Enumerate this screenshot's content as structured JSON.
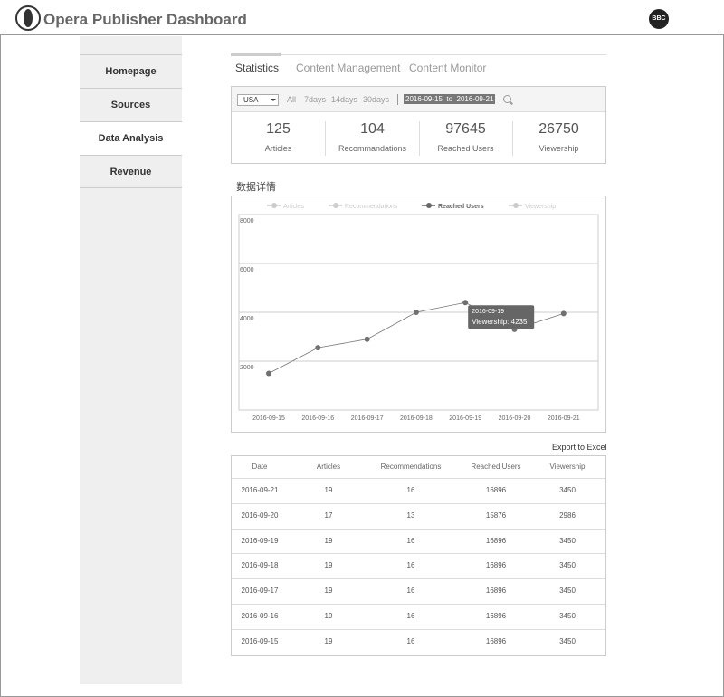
{
  "header": {
    "title": "Opera Publisher Dashboard",
    "avatar_text": "BBC"
  },
  "sidebar": {
    "items": [
      {
        "label": "Homepage"
      },
      {
        "label": "Sources"
      },
      {
        "label": "Data Analysis",
        "active": true
      },
      {
        "label": "Revenue"
      }
    ]
  },
  "tabs": [
    {
      "label": "Statistics",
      "active": true
    },
    {
      "label": "Content Management"
    },
    {
      "label": "Content Monitor"
    }
  ],
  "filters": {
    "country": "USA",
    "ranges": [
      "All",
      "7days",
      "14days",
      "30days"
    ],
    "date_from": "2016-09-15",
    "date_to_word": "to",
    "date_to": "2016-09-21"
  },
  "stats": [
    {
      "value": "125",
      "label": "Articles"
    },
    {
      "value": "104",
      "label": "Recommandations"
    },
    {
      "value": "97645",
      "label": "Reached Users"
    },
    {
      "value": "26750",
      "label": "Viewership"
    }
  ],
  "section_title": "数据详情",
  "chart_data": {
    "type": "line",
    "legend": [
      "Articles",
      "Recommendations",
      "Reached Users",
      "Viewership"
    ],
    "active_series": "Reached Users",
    "categories": [
      "2016-09-15",
      "2016-09-16",
      "2016-09-17",
      "2016-09-18",
      "2016-09-19",
      "2016-09-20",
      "2016-09-21"
    ],
    "series": [
      {
        "name": "Reached Users",
        "values": [
          1500,
          2550,
          2900,
          4000,
          4400,
          3300,
          3950
        ]
      }
    ],
    "yticks": [
      2000,
      4000,
      6000,
      8000
    ],
    "ylim": [
      0,
      8000
    ],
    "grid": true,
    "legend_position": "top",
    "tooltip": {
      "date": "2016-09-19",
      "text": "Viewership: 4235"
    }
  },
  "table": {
    "export_label": "Export to Excel",
    "columns": [
      "Date",
      "Articles",
      "Recommendations",
      "Reached Users",
      "Viewership"
    ],
    "rows": [
      [
        "2016-09-21",
        "19",
        "16",
        "16896",
        "3450"
      ],
      [
        "2016-09-20",
        "17",
        "13",
        "15876",
        "2986"
      ],
      [
        "2016-09-19",
        "19",
        "16",
        "16896",
        "3450"
      ],
      [
        "2016-09-18",
        "19",
        "16",
        "16896",
        "3450"
      ],
      [
        "2016-09-17",
        "19",
        "16",
        "16896",
        "3450"
      ],
      [
        "2016-09-16",
        "19",
        "16",
        "16896",
        "3450"
      ],
      [
        "2016-09-15",
        "19",
        "16",
        "16896",
        "3450"
      ]
    ]
  },
  "colors": {
    "line": "#777777",
    "point": "#707070",
    "tooltip_bg": "#666666",
    "legend_inactive": "#cccccc",
    "legend_active": "#666666"
  }
}
